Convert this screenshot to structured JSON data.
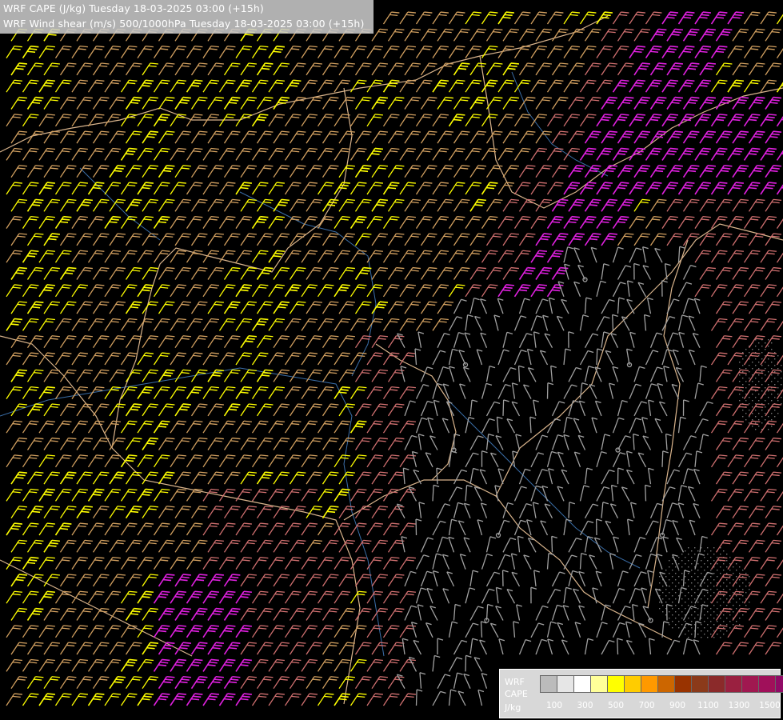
{
  "header": {
    "line1": "WRF CAPE (J/kg) Tuesday 18-03-2025 03:00 (+15h)",
    "line2": "WRF Wind shear (m/s) 500/1000hPa Tuesday 18-03-2025 03:00 (+15h)"
  },
  "legend": {
    "label_model": "WRF",
    "label_field": "CAPE",
    "label_unit": "J/kg",
    "colors": [
      "#bbbbbb",
      "#e6e6e6",
      "#ffffff",
      "#ffff99",
      "#ffff00",
      "#ffcc00",
      "#ff9900",
      "#cc6600",
      "#993300",
      "#8b3a1a",
      "#8b2a2a",
      "#9a2040",
      "#a01850",
      "#a0105a",
      "#900a66",
      "#800080",
      "#aa00aa",
      "#cc00cc"
    ],
    "ticks": [
      "100",
      "300",
      "500",
      "700",
      "900",
      "1100",
      "1300",
      "1500"
    ]
  },
  "map": {
    "background": "#000000",
    "border_color": "#d9b48c",
    "river_color": "#3a6ea8",
    "barb_colors": {
      "light": "#a0a0a0",
      "yellow": "#ffff00",
      "tan": "#d2a060",
      "salmon": "#d07070",
      "magenta": "#e020e0"
    }
  }
}
